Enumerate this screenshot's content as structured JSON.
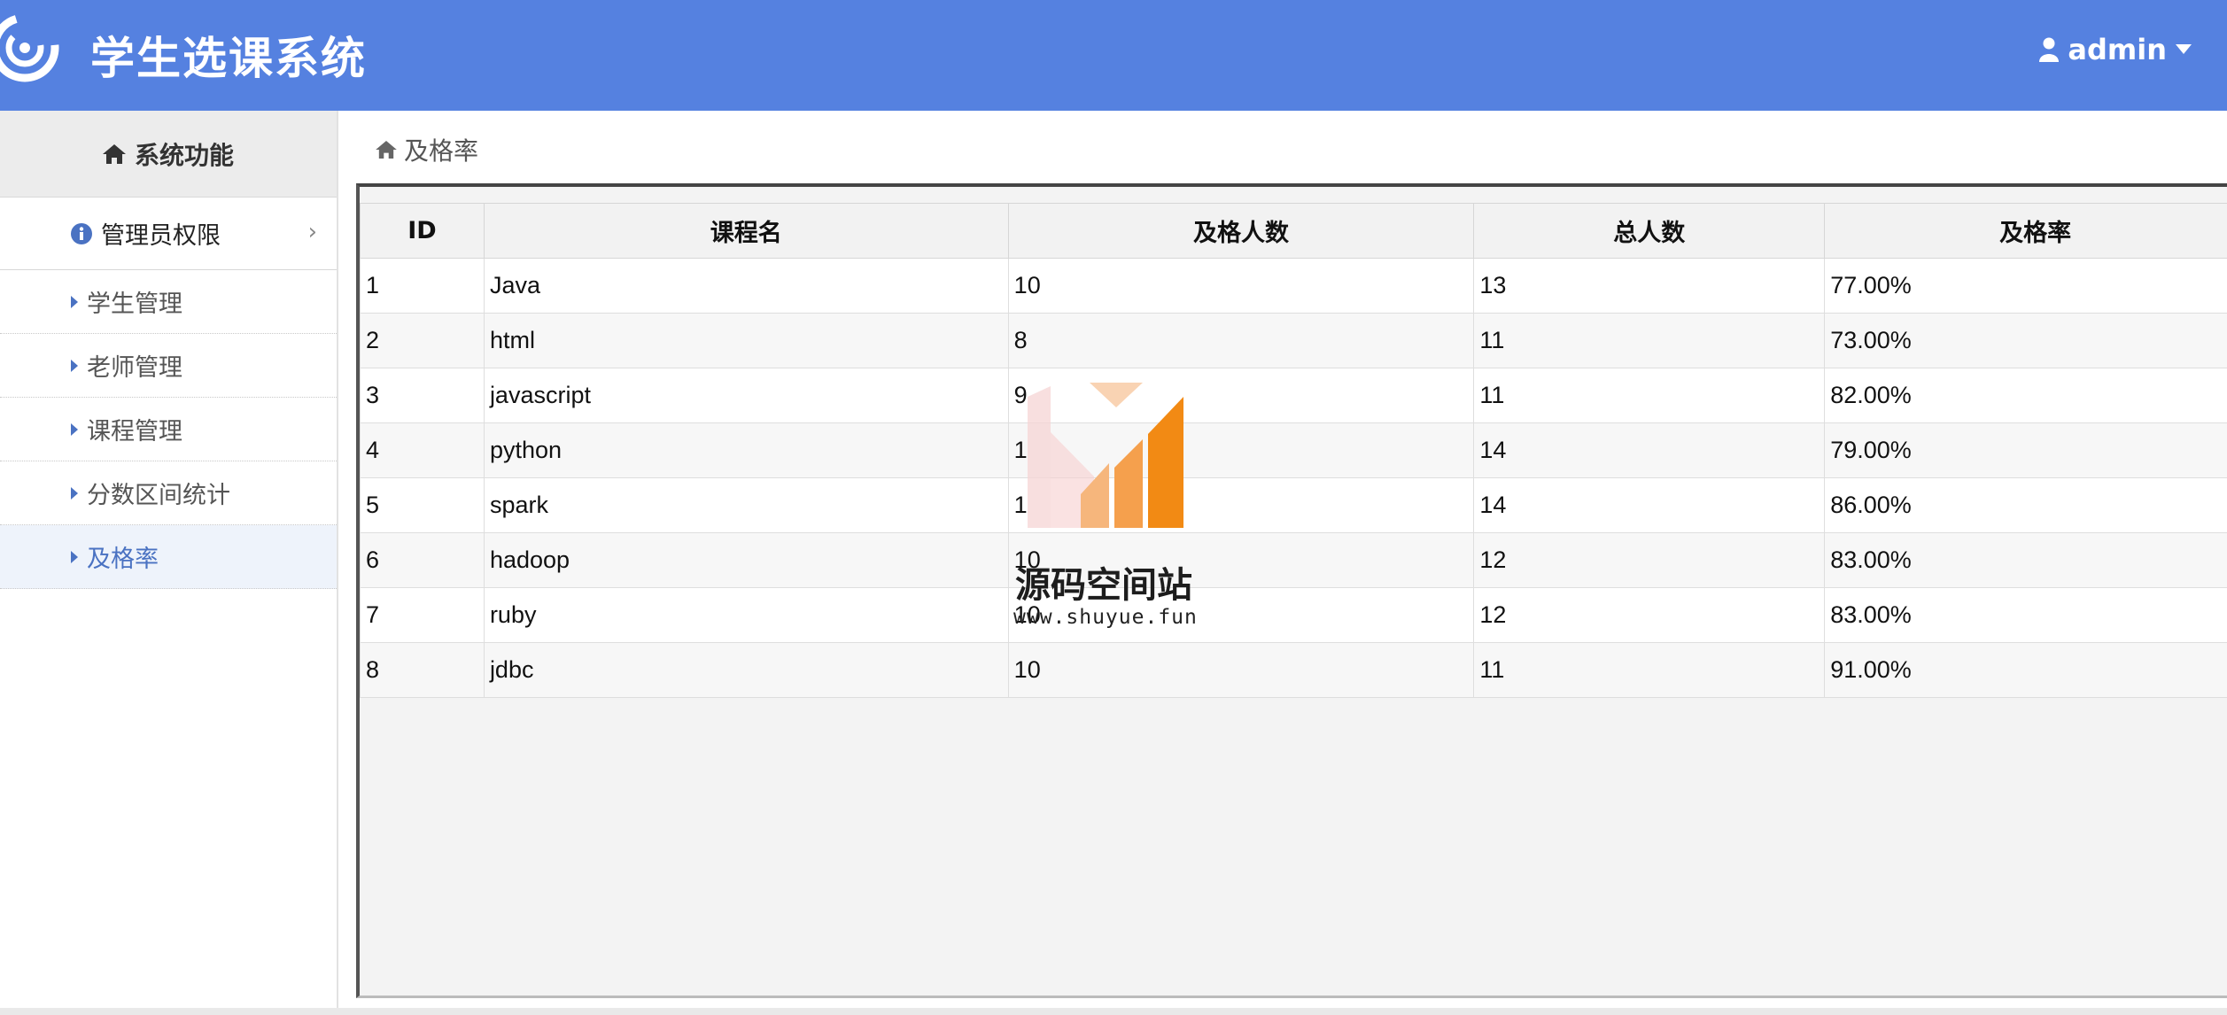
{
  "header": {
    "title": "学生选课系统",
    "user": "admin",
    "bg_color": "#5581e0"
  },
  "sidebar": {
    "title": "系统功能",
    "group": "管理员权限",
    "items": [
      {
        "label": "学生管理"
      },
      {
        "label": "老师管理"
      },
      {
        "label": "课程管理"
      },
      {
        "label": "分数区间统计"
      },
      {
        "label": "及格率",
        "active": true
      }
    ]
  },
  "breadcrumb": "及格率",
  "table": {
    "columns": [
      "ID",
      "课程名",
      "及格人数",
      "总人数",
      "及格率"
    ],
    "rows": [
      [
        "1",
        "Java",
        "10",
        "13",
        "77.00%"
      ],
      [
        "2",
        "html",
        "8",
        "11",
        "73.00%"
      ],
      [
        "3",
        "javascript",
        "9",
        "11",
        "82.00%"
      ],
      [
        "4",
        "python",
        "1",
        "14",
        "79.00%"
      ],
      [
        "5",
        "spark",
        "1",
        "14",
        "86.00%"
      ],
      [
        "6",
        "hadoop",
        "10",
        "12",
        "83.00%"
      ],
      [
        "7",
        "ruby",
        "10",
        "12",
        "83.00%"
      ],
      [
        "8",
        "jdbc",
        "10",
        "11",
        "91.00%"
      ]
    ]
  },
  "watermark": {
    "line1": "源码空间站",
    "line2": "www.shuyue.fun"
  }
}
